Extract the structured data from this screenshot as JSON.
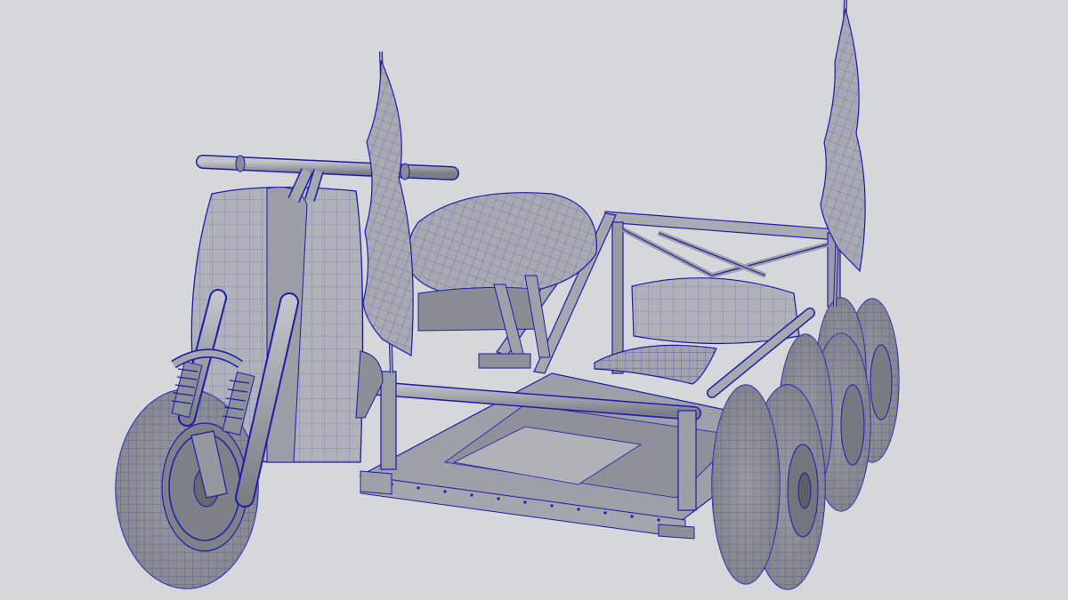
{
  "viewport": {
    "background": "#d6d7db",
    "wire_color": "#1c1ca8",
    "surface_color": "#9a9ca4",
    "surface_light": "#b8bac0",
    "surface_dark": "#6e7078"
  },
  "model": {
    "parts": [
      "handlebar",
      "front-fork",
      "front-wheel",
      "fuel-tank",
      "flag-left",
      "flag-right",
      "seat-cushion",
      "pillow-back",
      "pillow-small",
      "frame-rail",
      "deck-plate",
      "rear-wheels"
    ]
  }
}
